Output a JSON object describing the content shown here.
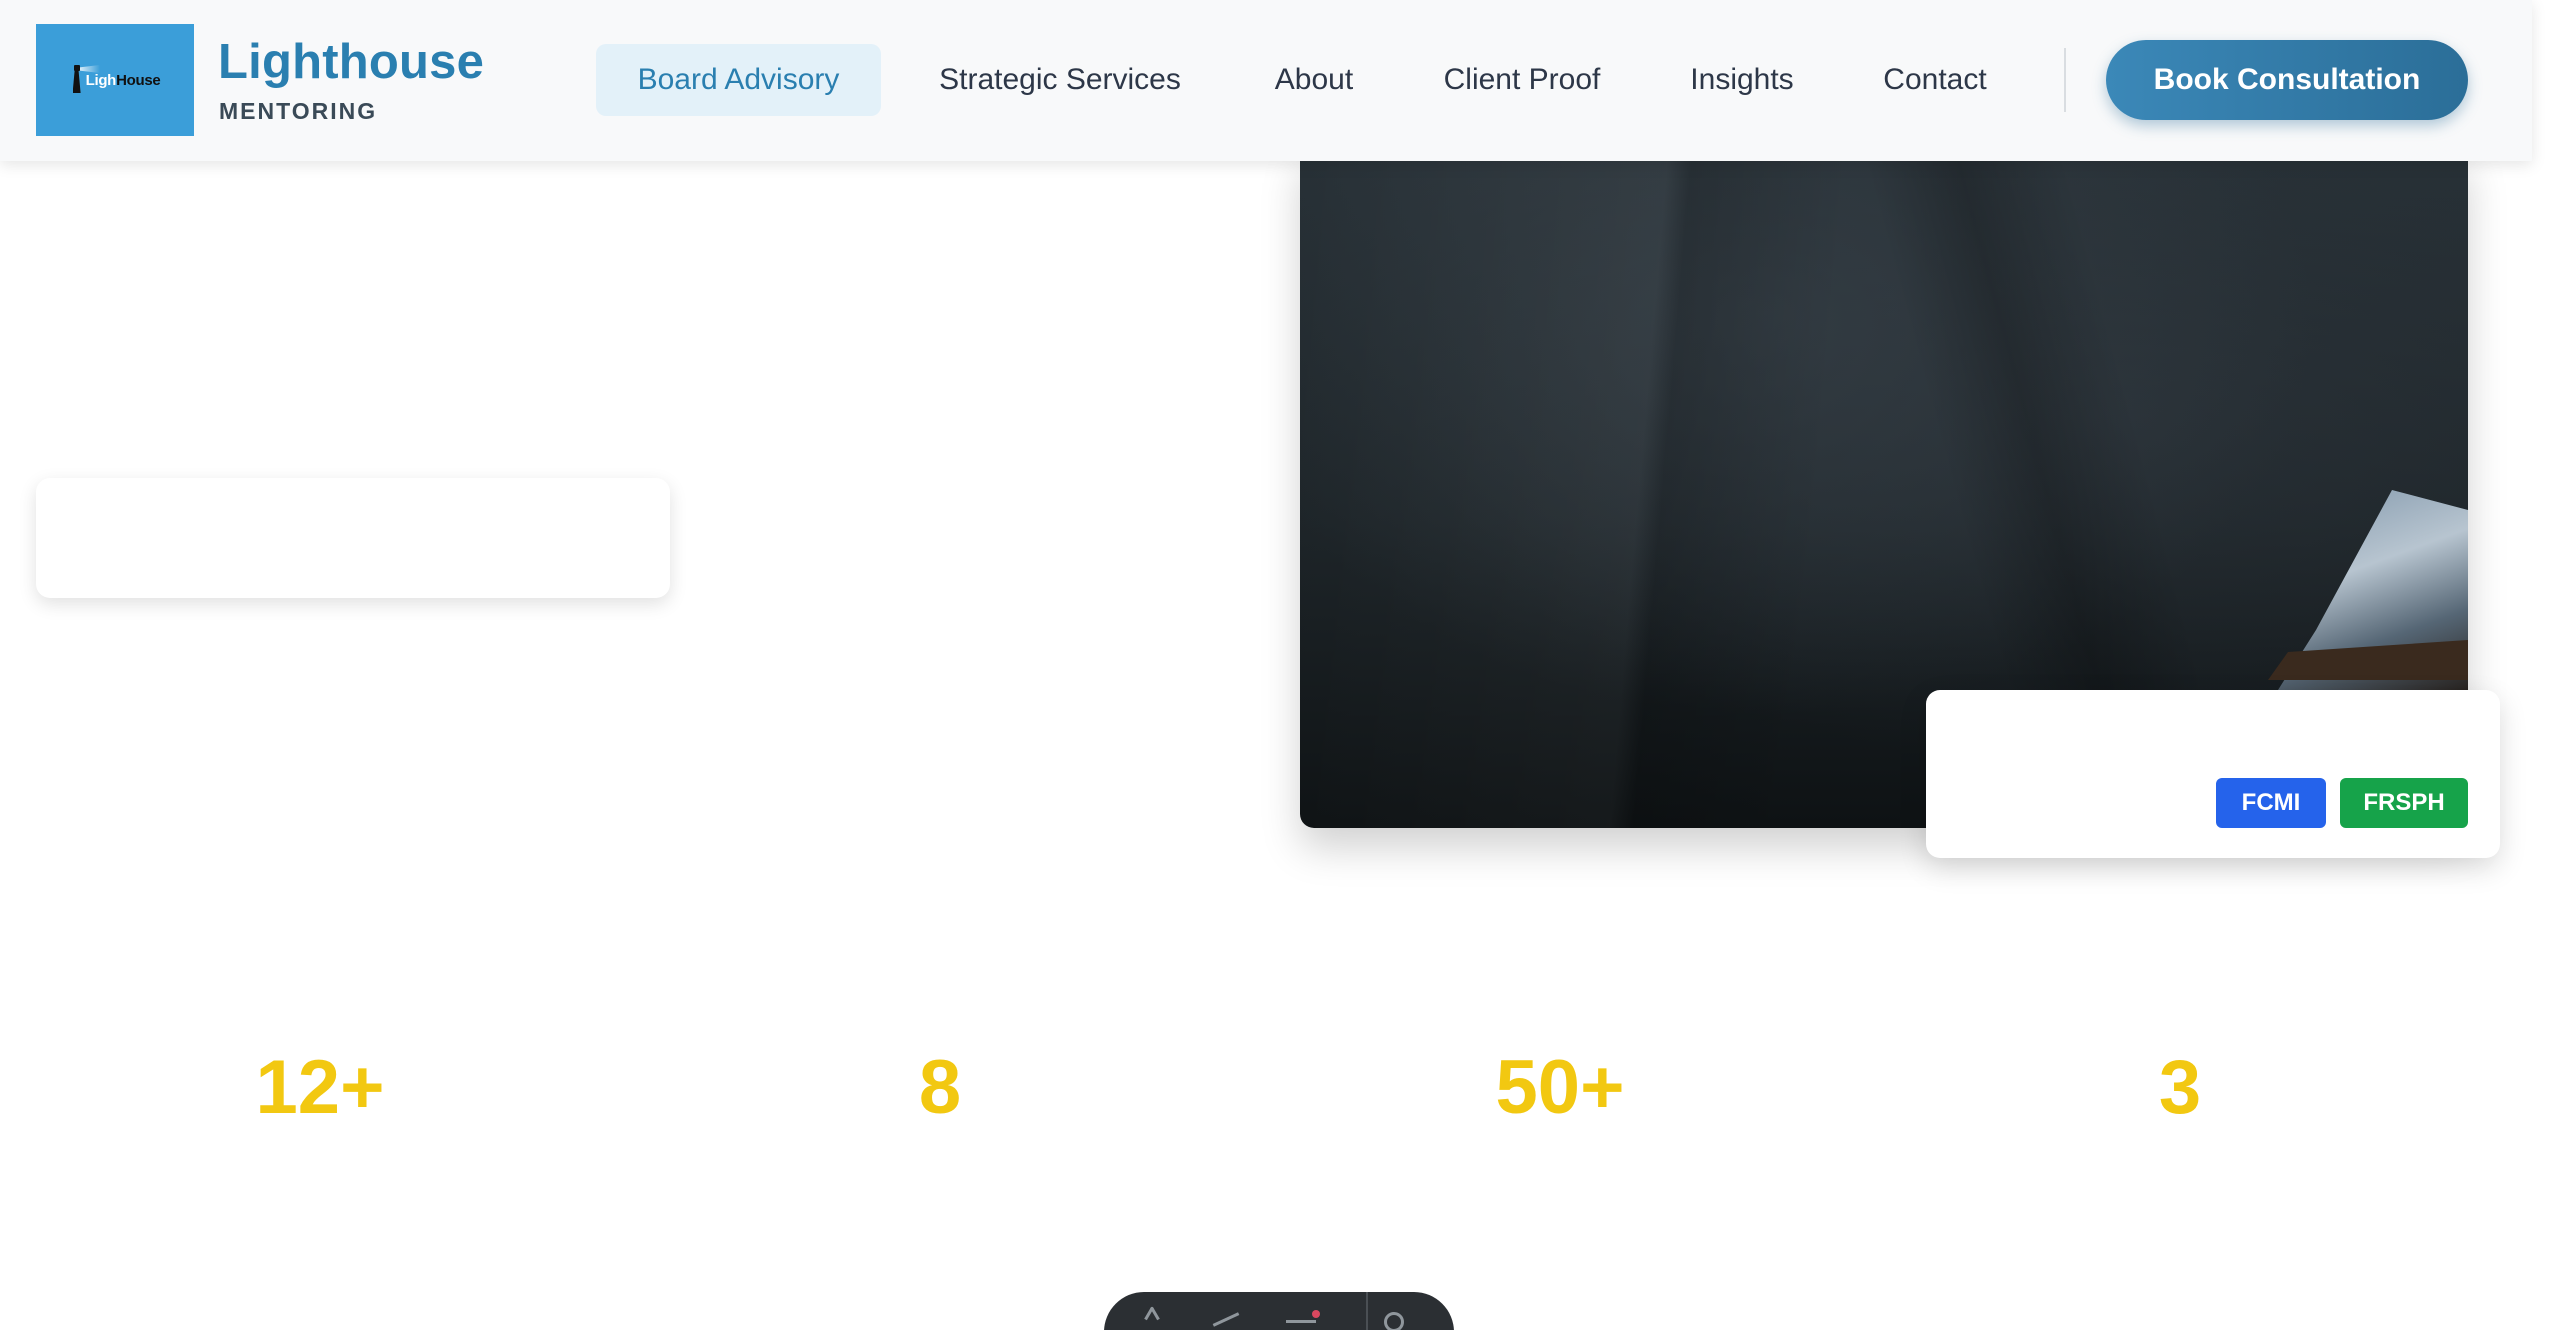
{
  "brand": {
    "logo_text_light": "Ligh",
    "logo_text_dark": "House",
    "title": "Lighthouse",
    "subtitle": "MENTORING"
  },
  "nav": {
    "items": [
      {
        "label": "Board Advisory",
        "active": true
      },
      {
        "label": "Strategic Services",
        "active": false
      },
      {
        "label": "About",
        "active": false
      },
      {
        "label": "Client Proof",
        "active": false
      },
      {
        "label": "Insights",
        "active": false
      },
      {
        "label": "Contact",
        "active": false
      }
    ],
    "cta_label": "Book Consultation"
  },
  "credentials": {
    "badges": [
      {
        "label": "FCMI",
        "color": "#2563eb"
      },
      {
        "label": "FRSPH",
        "color": "#16a34a"
      }
    ]
  },
  "stats": [
    "12+",
    "8",
    "50+",
    "3"
  ],
  "toolbar": {
    "icons": [
      "text-icon",
      "pen-icon",
      "highlight-icon",
      "settings-icon"
    ]
  },
  "colors": {
    "brand": "#2a7fb0",
    "accent_stat": "#f2c811",
    "nav_active_bg": "#e3f1f9"
  }
}
